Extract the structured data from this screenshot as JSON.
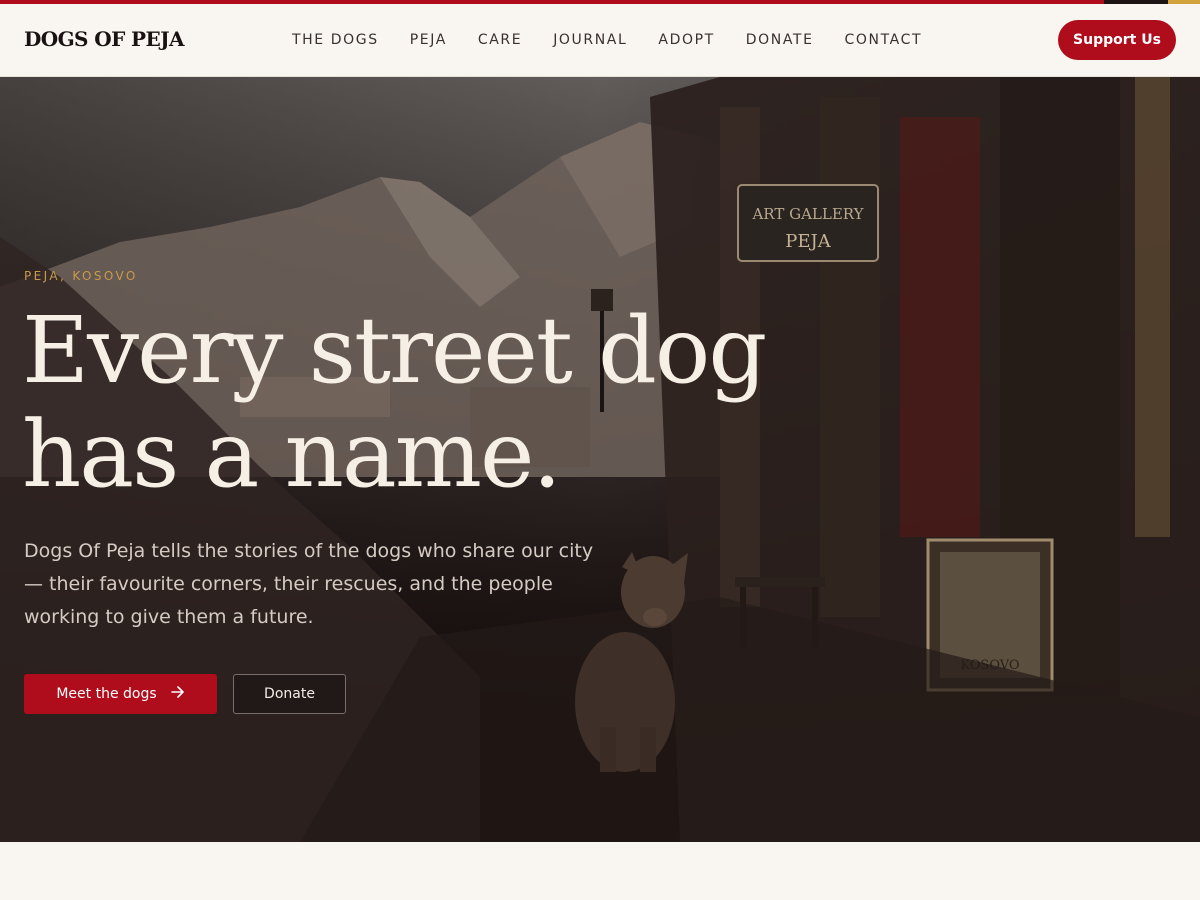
{
  "site": {
    "logo": "DOGS OF PEJA",
    "nav": [
      "THE DOGS",
      "PEJA",
      "CARE",
      "JOURNAL",
      "ADOPT",
      "DONATE",
      "CONTACT"
    ],
    "support_label": "Support Us"
  },
  "hero": {
    "eyebrow": "PEJA, KOSOVO",
    "headline_line1": "Every street dog",
    "headline_line2": "has a name.",
    "subtext": "Dogs Of Peja tells the stories of the dogs who share our city — their favourite corners, their rescues, and the people working to give them a future.",
    "primary_label": "Meet the dogs",
    "primary_icon": "arrow-right-icon",
    "secondary_label": "Donate",
    "sign_text_1": "ART GALLERY",
    "sign_text_2": "PEJA",
    "poster_text": "KOSOVO"
  },
  "colors": {
    "accent": "#b00d1c",
    "gold": "#c99a4a",
    "background": "#f9f6f1",
    "dark": "#1a1212"
  }
}
